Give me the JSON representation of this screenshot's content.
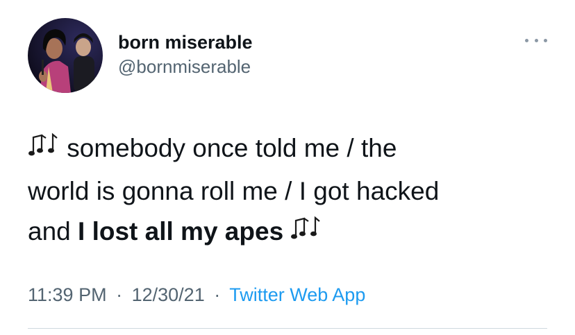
{
  "tweet": {
    "author": {
      "display_name": "born miserable",
      "handle": "@bornmiserable"
    },
    "text": {
      "line1": "somebody once told me / the",
      "line2": "world is gonna roll me / I got hacked",
      "line3_plain": "and ",
      "line3_bold": "I lost all my apes"
    },
    "icons": [
      "music-notes-icon",
      "more-icon"
    ],
    "time": "11:39 PM",
    "date": "12/30/21",
    "separator": "·",
    "source": "Twitter Web App"
  },
  "colors": {
    "text": "#0f1419",
    "secondary": "#536471",
    "link": "#1d9bf0",
    "divider": "#cfd9de"
  }
}
